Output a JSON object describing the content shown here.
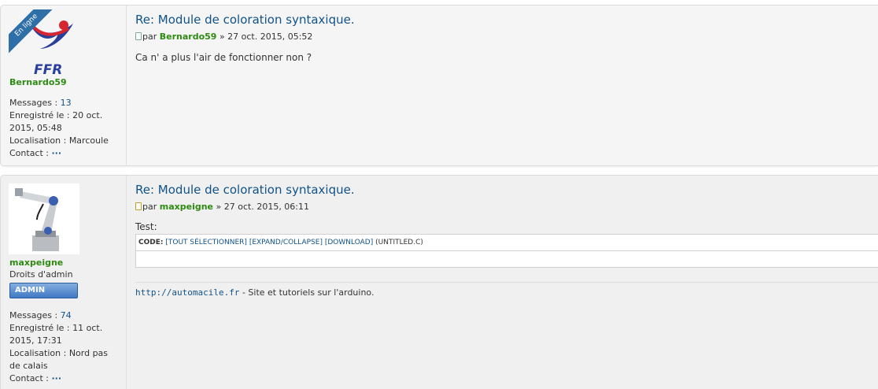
{
  "posts": [
    {
      "online_label": "En ligne",
      "avatar_text": "FFR",
      "username": "Bernardo59",
      "details": {
        "messages_label": "Messages :",
        "messages_value": "13",
        "registered_label": "Enregistré le :",
        "registered_value": "20 oct. 2015, 05:48",
        "location_label": "Localisation :",
        "location_value": "Marcoule",
        "contact_label": "Contact :",
        "contact_value": "···"
      },
      "title": "Re: Module de coloration syntaxique.",
      "by_label": "par",
      "author": "Bernardo59",
      "date": "» 27 oct. 2015, 05:52",
      "content": "Ca n' a plus l'air de fonctionner non ?"
    },
    {
      "username": "maxpeigne",
      "rank": "Droits d'admin",
      "rank_badge": "ADMIN",
      "details": {
        "messages_label": "Messages :",
        "messages_value": "74",
        "registered_label": "Enregistré le :",
        "registered_value": "11 oct. 2015, 17:31",
        "location_label": "Localisation :",
        "location_value": "Nord pas de calais",
        "contact_label": "Contact :",
        "contact_value": "···"
      },
      "title": "Re: Module de coloration syntaxique.",
      "by_label": "par",
      "author": "maxpeigne",
      "date": "» 27 oct. 2015, 06:11",
      "content": "Test:",
      "code": {
        "label": "CODE:",
        "select_all": "[TOUT SÉLECTIONNER]",
        "expand": "[EXPAND/COLLAPSE]",
        "download": "[DOWNLOAD]",
        "filename": "(UNTITLED.C)"
      },
      "signature": {
        "link": "http://automacile.fr",
        "text": " - Site et tutoriels sur l'arduino."
      }
    }
  ],
  "colors": {
    "link": "#105289",
    "username": "#2e8b13",
    "online_ribbon": "#2f6fa7",
    "admin_badge": "#3f78c4"
  }
}
